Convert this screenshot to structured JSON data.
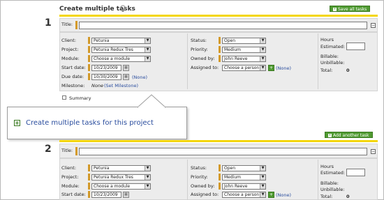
{
  "header": {
    "title": "Create multiple tasks",
    "save_all_label": "Save all tasks"
  },
  "add_another_label": "Add another task",
  "callout": {
    "text": "Create multiple tasks for this project"
  },
  "tasks": [
    {
      "number": "1",
      "title_label": "Title:",
      "title_value": "",
      "client_label": "Client:",
      "client_value": "Petunia",
      "project_label": "Project:",
      "project_value": "Petunia Redux Tres",
      "module_label": "Module:",
      "module_value": "Choose a module",
      "start_label": "Start date:",
      "start_value": "10/23/2009",
      "due_label": "Due date:",
      "due_value": "10/30/2009",
      "due_none": "(None)",
      "milestone_label": "Milestone:",
      "milestone_value": "None",
      "milestone_link": "(Set Milestone)",
      "status_label": "Status:",
      "status_value": "Open",
      "priority_label": "Priority:",
      "priority_value": "Medium",
      "owned_label": "Owned by:",
      "owned_value": "John Reeve",
      "assigned_label": "Assigned to:",
      "assigned_value": "Choose a person",
      "assigned_none": "(None)",
      "hours_label": "Hours",
      "estimated_label": "Estimated:",
      "billable_label": "Billable:",
      "unbillable_label": "Unbillable:",
      "total_label": "Total:",
      "total_value": "0",
      "summary_label": "Summary"
    },
    {
      "number": "2",
      "title_label": "Title:",
      "title_value": "",
      "client_label": "Client:",
      "client_value": "Petunia",
      "project_label": "Project:",
      "project_value": "Petunia Redux Tres",
      "module_label": "Module:",
      "module_value": "Choose a module",
      "start_label": "Start date:",
      "start_value": "10/23/2009",
      "status_label": "Status:",
      "status_value": "Open",
      "priority_label": "Priority:",
      "priority_value": "Medium",
      "owned_label": "Owned by:",
      "owned_value": "John Reeve",
      "assigned_label": "Assigned to:",
      "assigned_value": "Choose a person",
      "assigned_none": "(None)",
      "hours_label": "Hours",
      "estimated_label": "Estimated:",
      "billable_label": "Billable:",
      "unbillable_label": "Unbillable:",
      "total_label": "Total:",
      "total_value": "0"
    }
  ],
  "icons": {
    "bulb": "lightbulb-icon",
    "calendar": "calendar-icon",
    "collapse": "collapse-icon",
    "add": "plus-icon"
  },
  "colors": {
    "accent_yellow": "#f4d60a",
    "button_green": "#4f9a31",
    "required_marker": "#d39a2a",
    "link": "#2a4d9e"
  }
}
